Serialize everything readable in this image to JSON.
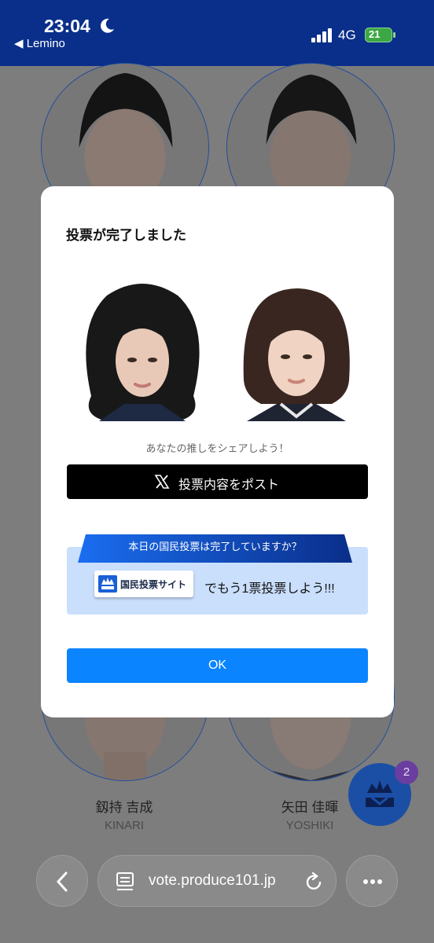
{
  "status_bar": {
    "time": "23:04",
    "back_app": "◀ Lemino",
    "network": "4G",
    "battery": "21"
  },
  "background_page": {
    "members": [
      {
        "name_jp": "",
        "name_en": ""
      },
      {
        "name_jp": "",
        "name_en": ""
      },
      {
        "name_jp": "釼持 吉成",
        "name_en": "KINARI"
      },
      {
        "name_jp": "矢田 佳暉",
        "name_en": "YOSHIKI"
      }
    ],
    "fab_badge": "2"
  },
  "modal": {
    "title": "投票が完了しました",
    "share_text": "あなたの推しをシェアしよう！",
    "post_button": "投票内容をポスト",
    "promo": {
      "ribbon": "本日の国民投票は完了していますか？",
      "site_button": "国民投票サイト",
      "text": "でもう1票投票しよう!!!"
    },
    "ok_button": "OK"
  },
  "browser": {
    "url": "vote.produce101.jp"
  },
  "colors": {
    "status_bg": "#0a2f8a",
    "ok_button": "#0b84ff",
    "promo_bg": "#c9dffc",
    "fab": "#1b4fa5"
  }
}
